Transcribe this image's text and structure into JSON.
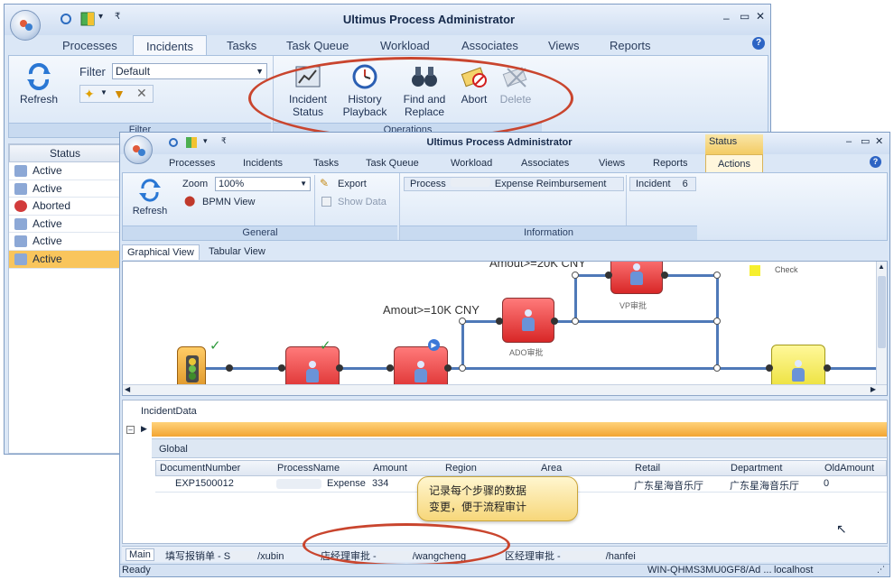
{
  "back_window": {
    "title": "Ultimus Process Administrator",
    "menu_tabs": [
      "Processes",
      "Incidents",
      "Tasks",
      "Task Queue",
      "Workload",
      "Associates",
      "Views",
      "Reports"
    ],
    "active_tab": "Incidents",
    "refresh_label": "Refresh",
    "filter_label": "Filter",
    "filter_value": "Default",
    "filter_group_label": "Filter",
    "operations": [
      {
        "label_line1": "Incident",
        "label_line2": "Status",
        "icon": "chart-icon"
      },
      {
        "label_line1": "History",
        "label_line2": "Playback",
        "icon": "clock-icon"
      },
      {
        "label_line1": "Find and",
        "label_line2": "Replace",
        "icon": "binoculars-icon"
      },
      {
        "label_line1": "Abort",
        "label_line2": "",
        "icon": "abort-icon"
      },
      {
        "label_line1": "Delete",
        "label_line2": "",
        "icon": "delete-icon"
      }
    ],
    "operations_group_label": "Operations",
    "status_header": "Status",
    "status_rows": [
      "Active",
      "Active",
      "Aborted",
      "Active",
      "Active",
      "Active"
    ]
  },
  "front_window": {
    "title": "Ultimus Process Administrator",
    "context_tab_header": "Status",
    "menu_tabs": [
      "Processes",
      "Incidents",
      "Tasks",
      "Task Queue",
      "Workload",
      "Associates",
      "Views",
      "Reports",
      "Actions"
    ],
    "active_tab": "Actions",
    "refresh_label": "Refresh",
    "zoom_label": "Zoom",
    "zoom_value": "100%",
    "bpmn_label": "BPMN View",
    "export_label": "Export",
    "show_data_label": "Show Data",
    "general_group_label": "General",
    "process_label": "Process",
    "process_value": "Expense Reimbursement",
    "incident_label": "Incident",
    "incident_value": "6",
    "information_group_label": "Information",
    "view_tabs": [
      "Graphical View",
      "Tabular View"
    ],
    "diagram": {
      "label_20k": "Amout>=20K CNY",
      "label_10k": "Amout>=10K CNY",
      "vp_label": "VP审批",
      "ado_label": "ADO审批",
      "check_label": "Check"
    },
    "incident_data_label": "IncidentData",
    "global_label": "Global",
    "columns": [
      "DocumentNumber",
      "ProcessName",
      "Amount",
      "Region",
      "Area",
      "Retail",
      "Department",
      "OldAmount"
    ],
    "row": {
      "DocumentNumber": "EXP1500012",
      "ProcessName": "Expense",
      "Amount": "334",
      "Region": "",
      "Area": "",
      "Retail": "广东星海音乐厅",
      "Department": "广东星海音乐厅",
      "OldAmount": "0"
    },
    "callout_line1": "记录每个步骤的数据",
    "callout_line2": "变更，便于流程审计",
    "bottom_tabs": [
      "Main",
      "填写报销单 - S",
      "/xubin",
      "店经理审批 -",
      "/wangcheng",
      "区经理审批 -",
      "/hanfei"
    ],
    "status_ready": "Ready",
    "status_machine": "WIN-QHMS3MU0GF8/Ad ...",
    "status_host": "localhost"
  }
}
